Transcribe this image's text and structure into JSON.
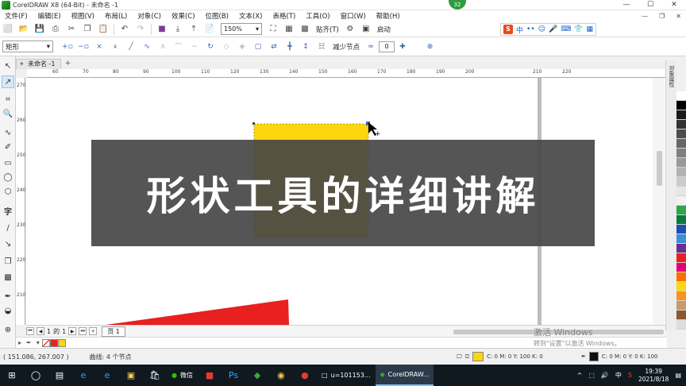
{
  "window": {
    "title": "CorelDRAW X8 (64-Bit) - 未命名 -1",
    "notification_count": "32",
    "minimize": "—",
    "maximize": "☐",
    "close": "✕"
  },
  "menu": {
    "items": [
      "文件(F)",
      "编辑(E)",
      "视图(V)",
      "布局(L)",
      "对象(C)",
      "效果(C)",
      "位图(B)",
      "文本(X)",
      "表格(T)",
      "工具(O)",
      "窗口(W)",
      "帮助(H)"
    ],
    "mdi_minimize": "—",
    "mdi_restore": "❐",
    "mdi_close": "✕"
  },
  "toolbar": {
    "zoom_value": "150%",
    "snap_label": "贴齐(T)",
    "launch_label": "启动",
    "ime_label": "中"
  },
  "propbar": {
    "shape_select": "矩形",
    "reduce_nodes": "减少节点",
    "spin_value": "0"
  },
  "document": {
    "tab_name": "未命名 -1",
    "add_tab": "+"
  },
  "ruler": {
    "top_labels": [
      "60",
      "70",
      "80",
      "90",
      "100",
      "110",
      "120",
      "130",
      "140",
      "150",
      "160",
      "170",
      "180",
      "190",
      "200",
      "210",
      "220"
    ],
    "left_labels": [
      "270",
      "260",
      "250",
      "240",
      "230",
      "220",
      "210"
    ]
  },
  "pager": {
    "current": "1",
    "of_label": "的",
    "total": "1",
    "page_tab": "页 1"
  },
  "status": {
    "coords": "( 151.086, 267.007 )",
    "nodes_info": "曲线: 4 个节点",
    "fill_info": "C: 0 M: 0 Y: 100 K: 0",
    "outline_info": "C: 0 M: 0 Y: 0 K: 100"
  },
  "watermark": {
    "line1": "激活 Windows",
    "line2": "转到\"设置\"以激活 Windows。"
  },
  "docker": {
    "label": "对象属性"
  },
  "taskbar": {
    "apps": [
      {
        "label": "微信"
      },
      {
        "label": "u=101153..."
      },
      {
        "label": "CorelDRAW..."
      }
    ],
    "ime": "中",
    "time": "19:39",
    "date": "2021/8/18"
  },
  "overlay": {
    "title": "形状工具的详细讲解"
  },
  "colors": {
    "accent_yellow": "#fcd60f",
    "red": "#e8201f",
    "palette": [
      "#ffffff",
      "#000000",
      "#1a1a1a",
      "#333333",
      "#4d4d4d",
      "#666666",
      "#808080",
      "#999999",
      "#b3b3b3",
      "#cccccc",
      "#e6e6e6",
      "#f2f2f2",
      "#2aa84a",
      "#0a7a3a",
      "#1f4fb5",
      "#3a8fdc",
      "#6c2b8e",
      "#e8201f",
      "#e3007a",
      "#ff6d00",
      "#fcd60f",
      "#f7931e",
      "#c69c6d",
      "#8a5a2b",
      "#dddddd"
    ]
  }
}
